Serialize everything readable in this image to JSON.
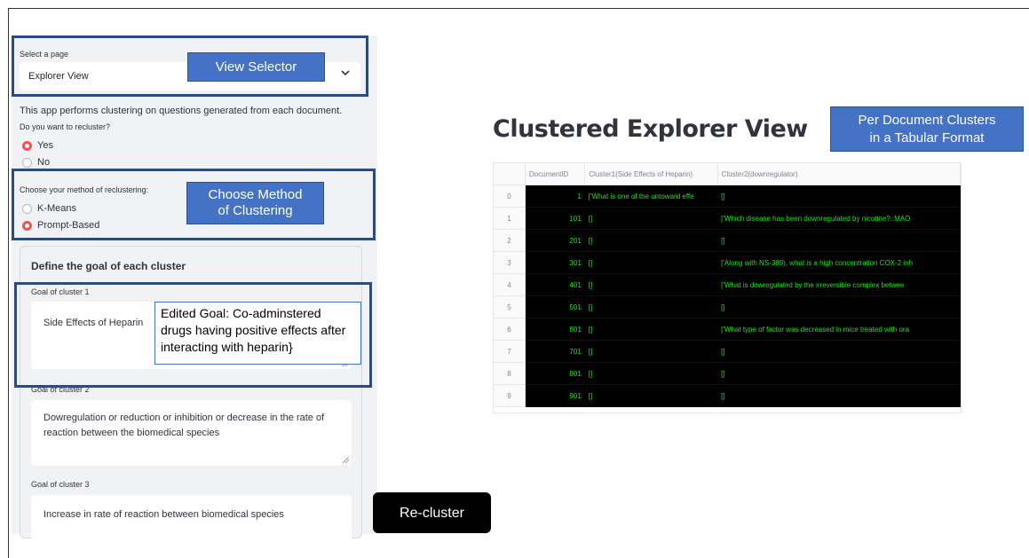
{
  "sidebar": {
    "select_label": "Select a page",
    "select_value": "Explorer View",
    "description": "This app performs clustering on questions generated from each document.",
    "recluster_question": "Do you want to recluster?",
    "recluster_options": [
      {
        "label": "Yes",
        "selected": true
      },
      {
        "label": "No",
        "selected": false
      }
    ],
    "method_question": "Choose your method of reclustering:",
    "method_options": [
      {
        "label": "K-Means",
        "selected": false
      },
      {
        "label": "Prompt-Based",
        "selected": true
      }
    ],
    "goals_heading": "Define the goal of each cluster",
    "goals": [
      {
        "label": "Goal of cluster 1",
        "value": "Side Effects of Heparin"
      },
      {
        "label": "Goal of cluster 2",
        "value": "Dowregulation or reduction or inhibition or decrease in the rate of reaction between the biomedical species"
      },
      {
        "label": "Goal of cluster 3",
        "value": "Increase in rate of reaction between biomedical species"
      }
    ]
  },
  "annotations": {
    "view_selector": "View Selector",
    "choose_method_line1": "Choose Method",
    "choose_method_line2": "of Clustering",
    "edited_goal": "Edited Goal: Co-adminstered drugs having positive effects after interacting with heparin}",
    "per_document_line1": "Per Document Clusters",
    "per_document_line2": "in a Tabular Format",
    "recluster_button": "Re-cluster"
  },
  "main": {
    "title": "Clustered Explorer View",
    "table": {
      "columns": [
        "DocumentID",
        "Cluster1(Side Effects of Heparin)",
        "Cluster2(downregulator)"
      ],
      "rows": [
        {
          "index": "0",
          "doc_id": "1",
          "c1": "['What is one of the untoward effe",
          "c2": "[]"
        },
        {
          "index": "1",
          "doc_id": "101",
          "c1": "[]",
          "c2": "['Which disease has been downregulated by nicotine?::MAO"
        },
        {
          "index": "2",
          "doc_id": "201",
          "c1": "[]",
          "c2": "[]"
        },
        {
          "index": "3",
          "doc_id": "301",
          "c1": "[]",
          "c2": "['Along with NS-389), what is a high concentration COX-2 inh"
        },
        {
          "index": "4",
          "doc_id": "401",
          "c1": "[]",
          "c2": "['What is dowregulated by the irreversible complex betwee"
        },
        {
          "index": "5",
          "doc_id": "501",
          "c1": "[]",
          "c2": "[]"
        },
        {
          "index": "6",
          "doc_id": "601",
          "c1": "[]",
          "c2": "['What type of factor was decreased in mice treated with ora"
        },
        {
          "index": "7",
          "doc_id": "701",
          "c1": "[]",
          "c2": "[]"
        },
        {
          "index": "8",
          "doc_id": "801",
          "c1": "[]",
          "c2": "[]"
        },
        {
          "index": "9",
          "doc_id": "901",
          "c1": "[]",
          "c2": "[]"
        }
      ]
    }
  },
  "colors": {
    "sidebar_bg": "#f0f2f6",
    "radio_selected": "#ff4b4b",
    "annotation_border": "#2f4b7c",
    "callout_fill": "#4472c4",
    "table_text": "#23e223"
  }
}
